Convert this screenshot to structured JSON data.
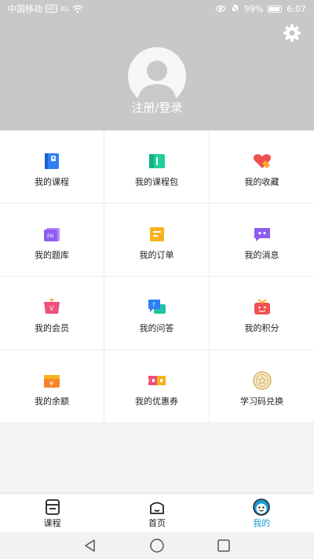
{
  "status_bar": {
    "carrier": "中国移动",
    "hd_tag": "HD",
    "network": "4G",
    "battery": "99%",
    "time": "6:07"
  },
  "header": {
    "login_label": "注册/登录",
    "settings_icon": "gear-icon",
    "avatar_icon": "user-silhouette-icon"
  },
  "menu": {
    "items": [
      {
        "label": "我的课程",
        "icon": "book-icon"
      },
      {
        "label": "我的课程包",
        "icon": "course-package-icon"
      },
      {
        "label": "我的收藏",
        "icon": "heart-icon"
      },
      {
        "label": "我的题库",
        "icon": "question-bank-icon"
      },
      {
        "label": "我的订单",
        "icon": "order-icon"
      },
      {
        "label": "我的消息",
        "icon": "message-icon"
      },
      {
        "label": "我的会员",
        "icon": "vip-icon"
      },
      {
        "label": "我的问答",
        "icon": "qa-icon"
      },
      {
        "label": "我的积分",
        "icon": "points-icon"
      },
      {
        "label": "我的余额",
        "icon": "wallet-icon"
      },
      {
        "label": "我的优惠券",
        "icon": "coupon-icon"
      },
      {
        "label": "学习码兑换",
        "icon": "star-coin-icon"
      }
    ]
  },
  "bottom_nav": {
    "items": [
      {
        "label": "课程",
        "icon": "course-icon"
      },
      {
        "label": "首页",
        "icon": "home-icon"
      },
      {
        "label": "我的",
        "icon": "profile-face-icon",
        "active": true
      }
    ]
  },
  "colors": {
    "header_bg": "#c8c8c8",
    "active_tab": "#1a9bd7"
  }
}
